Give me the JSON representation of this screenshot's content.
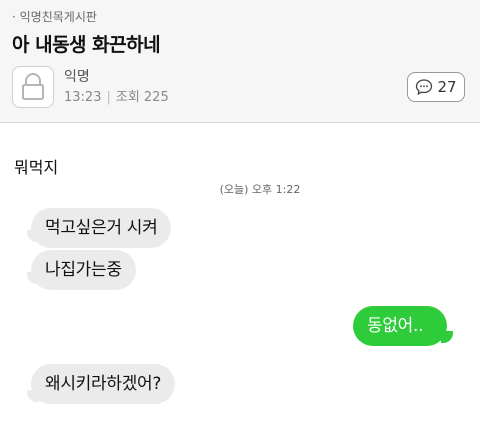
{
  "header": {
    "board": "· 익명친목게시판",
    "title": "아 내동생 화끈하네",
    "author": "익명",
    "time": "13:23",
    "views": "조회 225",
    "comment_count": "27"
  },
  "post": {
    "body": "뭐먹지"
  },
  "chat": {
    "timestamp": "(오늘) 오후 1:22",
    "messages": [
      {
        "side": "in",
        "text": "먹고싶은거 시켜"
      },
      {
        "side": "in",
        "text": "나집가는중"
      },
      {
        "side": "out",
        "text": "동없어.."
      },
      {
        "side": "in",
        "text": "왜시키라하겠어?"
      }
    ]
  },
  "colors": {
    "incoming_bubble": "#ebebeb",
    "outgoing_bubble": "#2ecc3a",
    "header_bg": "#f6f6f6"
  },
  "icons": [
    "lock-icon",
    "comment-bubble-icon"
  ]
}
